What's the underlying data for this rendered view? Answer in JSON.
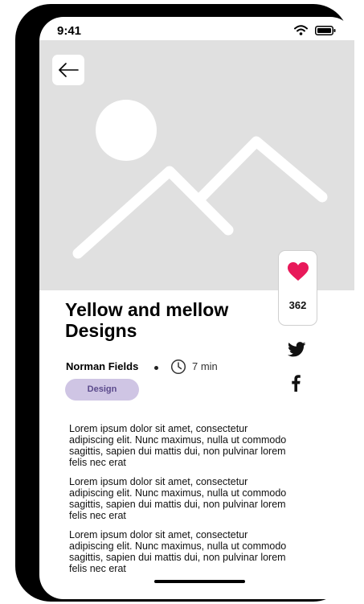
{
  "status_bar": {
    "time": "9:41",
    "icons": [
      "wifi-icon",
      "battery-icon"
    ]
  },
  "header": {
    "back_icon": "arrow-left-icon",
    "hero_image": "image-placeholder"
  },
  "actions": {
    "like_icon": "heart-icon",
    "like_count": "362",
    "like_color": "#e8195a",
    "share_icons": [
      "twitter-icon",
      "facebook-icon"
    ]
  },
  "article": {
    "title": "Yellow and mellow Designs",
    "author": "Norman Fields",
    "read_time": "7 min",
    "tag": "Design",
    "paragraphs": [
      "Lorem ipsum dolor sit amet, consectetur adipiscing elit. Nunc maximus, nulla ut commodo sagittis, sapien dui mattis dui, non pulvinar lorem felis nec erat",
      "Lorem ipsum dolor sit amet, consectetur adipiscing elit. Nunc maximus, nulla ut commodo sagittis, sapien dui mattis dui, non pulvinar lorem felis nec erat",
      "Lorem ipsum dolor sit amet, consectetur adipiscing elit. Nunc maximus, nulla ut commodo sagittis, sapien dui mattis dui, non pulvinar lorem felis nec erat"
    ]
  },
  "colors": {
    "tag_background": "#cfc5e4",
    "tag_text": "#5b4a8c",
    "hero_background": "#e0e0e0"
  }
}
